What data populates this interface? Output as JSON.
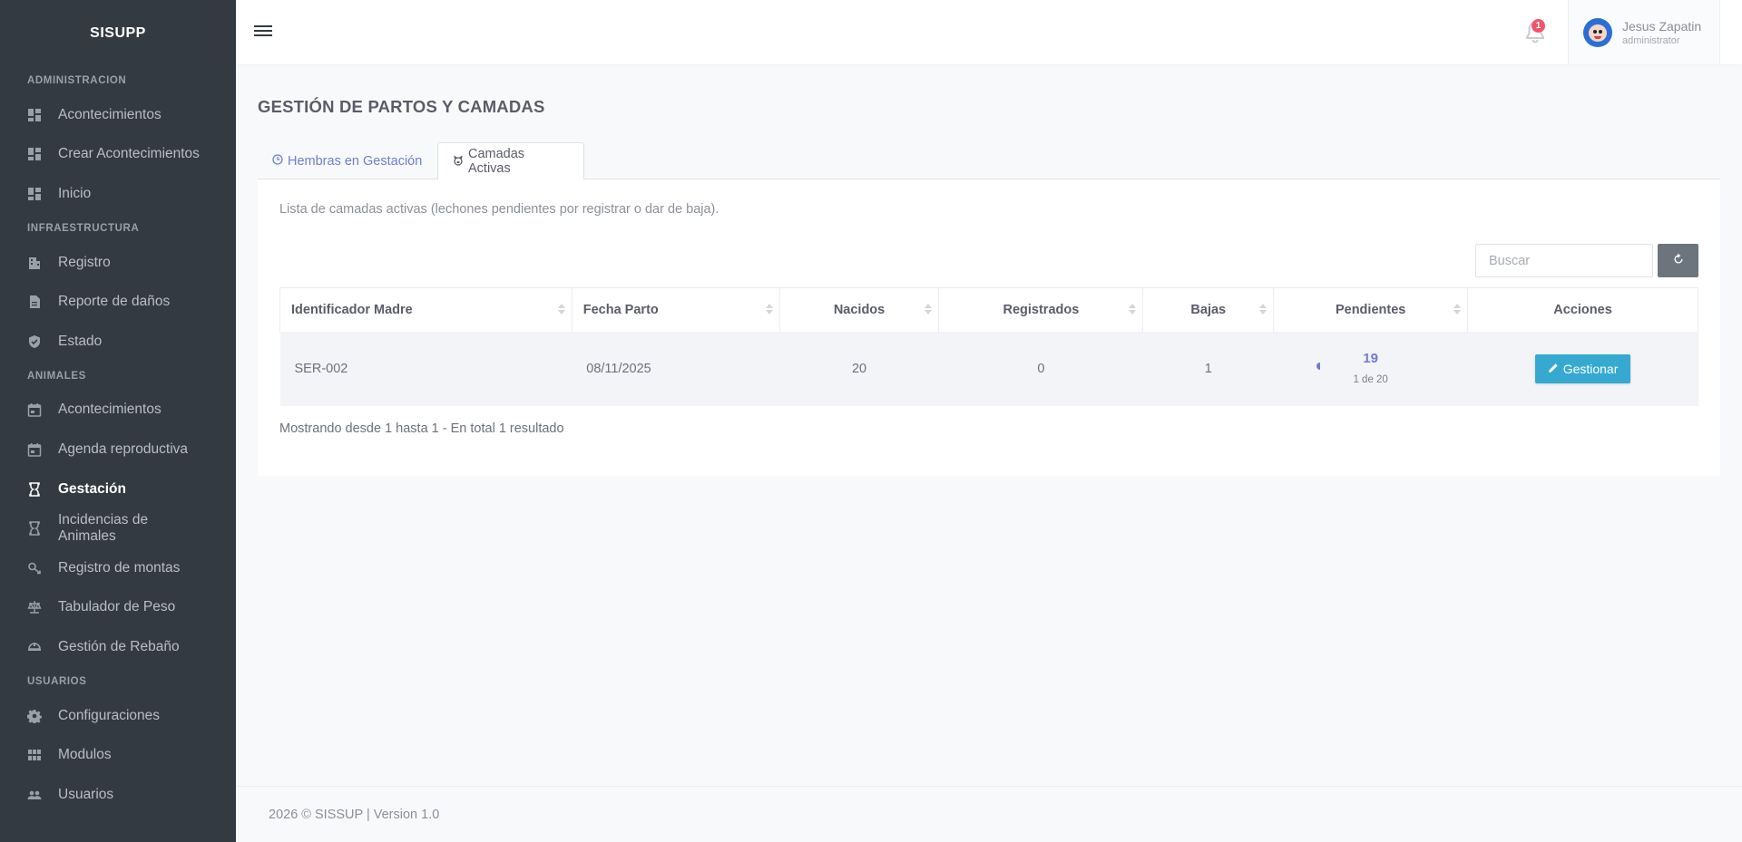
{
  "app": {
    "brand": "SISUPP"
  },
  "sidebar": {
    "sections": [
      {
        "title": "ADMINISTRACION",
        "items": [
          {
            "label": "Acontecimientos",
            "icon": "dashboard-icon"
          },
          {
            "label": "Crear Acontecimientos",
            "icon": "dashboard-icon"
          },
          {
            "label": "Inicio",
            "icon": "dashboard-icon"
          }
        ]
      },
      {
        "title": "INFRAESTRUCTURA",
        "items": [
          {
            "label": "Registro",
            "icon": "building-icon"
          },
          {
            "label": "Reporte de daños",
            "icon": "document-icon"
          },
          {
            "label": "Estado",
            "icon": "shield-check-icon"
          }
        ]
      },
      {
        "title": "ANIMALES",
        "items": [
          {
            "label": "Acontecimientos",
            "icon": "calendar-icon"
          },
          {
            "label": "Agenda reproductiva",
            "icon": "calendar-icon"
          },
          {
            "label": "Gestación",
            "icon": "hourglass-icon",
            "active": true
          },
          {
            "label": "Incidencias de Animales",
            "icon": "hourglass-icon"
          },
          {
            "label": "Registro de montas",
            "icon": "gender-icon"
          },
          {
            "label": "Tabulador de Peso",
            "icon": "scale-icon"
          },
          {
            "label": "Gestión de Rebaño",
            "icon": "helmet-icon"
          }
        ]
      },
      {
        "title": "USUARIOS",
        "items": [
          {
            "label": "Configuraciones",
            "icon": "gear-icon"
          },
          {
            "label": "Modulos",
            "icon": "grid-icon"
          },
          {
            "label": "Usuarios",
            "icon": "users-icon"
          }
        ]
      }
    ]
  },
  "topbar": {
    "notifications_count": "1",
    "user": {
      "name": "Jesus Zapatin",
      "role": "administrator"
    }
  },
  "main": {
    "title": "GESTIÓN DE PARTOS Y CAMADAS",
    "tabs": [
      {
        "label": "Hembras en Gestación",
        "icon": "clock-icon"
      },
      {
        "label": "Camadas Activas",
        "icon": "piglet-icon",
        "active": true
      }
    ],
    "description": "Lista de camadas activas (lechones pendientes por registrar o dar de baja).",
    "search_placeholder": "Buscar",
    "table": {
      "columns": [
        "Identificador Madre",
        "Fecha Parto",
        "Nacidos",
        "Registrados",
        "Bajas",
        "Pendientes",
        "Acciones"
      ],
      "rows": [
        {
          "madre": "SER-002",
          "fecha": "08/11/2025",
          "nacidos": "20",
          "registrados": "0",
          "bajas": "1",
          "pendientes": "19",
          "pendientes_sub": "1 de 20",
          "action": "Gestionar"
        }
      ]
    },
    "pagination_info": "Mostrando desde 1 hasta 1 - En total 1 resultado"
  },
  "footer": {
    "text": "2026 © SISSUP | Version 1.0"
  },
  "colors": {
    "sidebar_bg": "#343a42",
    "accent": "#6f7ed1",
    "button_info": "#35a9d0",
    "badge": "#f1556c"
  }
}
